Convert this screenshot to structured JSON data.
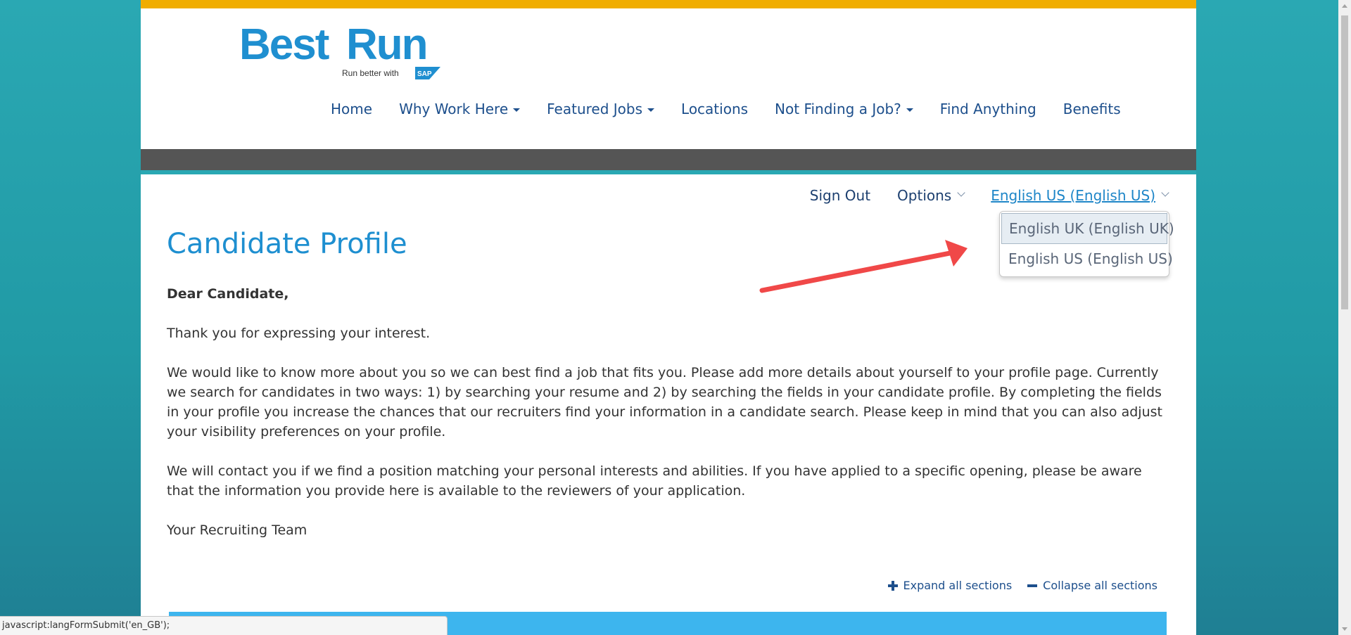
{
  "brand": {
    "logo_word1": "Best",
    "logo_word2": "Run",
    "tagline": "Run better with",
    "sap_label": "SAP",
    "colors": {
      "logo_blue": "#1f8fd0",
      "top_strip": "#f0ad00",
      "gray_band": "#555555",
      "teal": "#2aa8b3"
    }
  },
  "nav": {
    "items": [
      {
        "label": "Home",
        "dropdown": false
      },
      {
        "label": "Why Work Here",
        "dropdown": true
      },
      {
        "label": "Featured Jobs",
        "dropdown": true
      },
      {
        "label": "Locations",
        "dropdown": false
      },
      {
        "label": "Not Finding a Job?",
        "dropdown": true
      },
      {
        "label": "Find Anything",
        "dropdown": false
      },
      {
        "label": "Benefits",
        "dropdown": false
      }
    ]
  },
  "utility": {
    "sign_out": "Sign Out",
    "options": "Options",
    "language": "English US (English US)"
  },
  "language_dropdown": {
    "options": [
      {
        "label": "English UK (English UK)",
        "highlighted": true
      },
      {
        "label": "English US (English US)",
        "highlighted": false
      }
    ]
  },
  "content": {
    "title": "Candidate Profile",
    "greeting": "Dear Candidate,",
    "p1": "Thank you for expressing your interest.",
    "p2": "We would like to know more about you so we can best find a job that fits you. Please add more details about yourself to your profile page. Currently we search for candidates in two ways: 1) by searching your resume and 2) by searching the fields in your candidate profile. By completing the fields in your profile you increase the chances that our recruiters find your information in a candidate search. Please keep in mind that you can also adjust your visibility preferences on your profile.",
    "p3": "We will contact you if we find a position matching your personal interests and abilities. If you have applied to a specific opening, please be aware that the information you provide here is available to the reviewers of your application.",
    "signature": "Your Recruiting Team"
  },
  "sections": {
    "expand_all": "Expand all sections",
    "collapse_all": "Collapse all sections"
  },
  "status_bar": {
    "text": "javascript:langFormSubmit('en_GB');"
  },
  "annotation": {
    "arrow_color": "#f04848"
  }
}
